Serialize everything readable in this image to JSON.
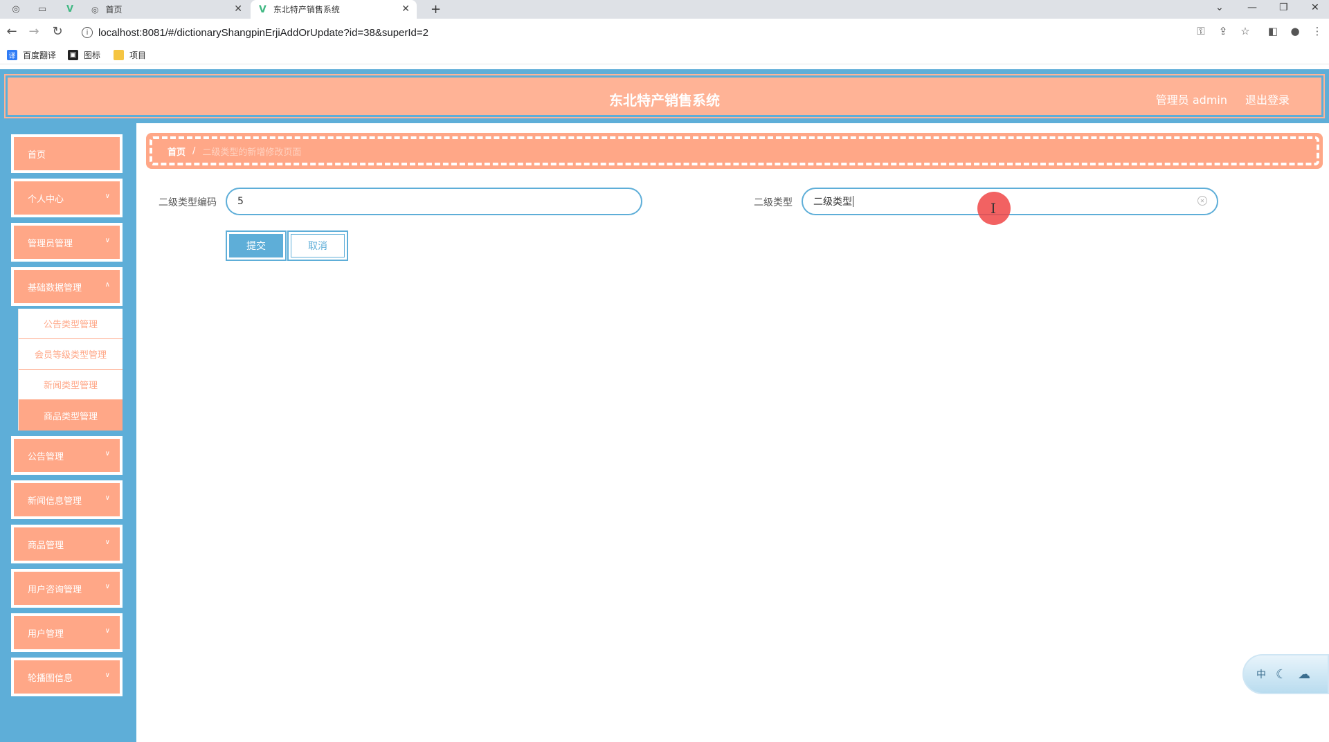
{
  "browser": {
    "tabs": [
      {
        "label": "首页",
        "active": false
      },
      {
        "label": "东北特产销售系统",
        "active": true
      }
    ],
    "new_tab": "+",
    "url": "localhost:8081/#/dictionaryShangpinErjiAddOrUpdate?id=38&superId=2",
    "bookmarks": [
      "百度翻译",
      "图标",
      "项目"
    ]
  },
  "header": {
    "title": "东北特产销售系统",
    "user": "管理员 admin",
    "logout": "退出登录"
  },
  "sidebar": {
    "items": [
      {
        "label": "首页",
        "has_arrow": false
      },
      {
        "label": "个人中心",
        "has_arrow": true
      },
      {
        "label": "管理员管理",
        "has_arrow": true
      },
      {
        "label": "基础数据管理",
        "has_arrow": true,
        "expanded": true
      },
      {
        "label": "公告管理",
        "has_arrow": true
      },
      {
        "label": "新闻信息管理",
        "has_arrow": true
      },
      {
        "label": "商品管理",
        "has_arrow": true
      },
      {
        "label": "用户咨询管理",
        "has_arrow": true
      },
      {
        "label": "用户管理",
        "has_arrow": true
      },
      {
        "label": "轮播图信息",
        "has_arrow": true
      }
    ],
    "submenu": [
      {
        "label": "公告类型管理",
        "active": false
      },
      {
        "label": "会员等级类型管理",
        "active": false
      },
      {
        "label": "新闻类型管理",
        "active": false
      },
      {
        "label": "商品类型管理",
        "active": true
      }
    ]
  },
  "breadcrumb": {
    "home": "首页",
    "separator": "/",
    "current": "二级类型的新增修改页面"
  },
  "form": {
    "code_label": "二级类型编码",
    "code_value": "5",
    "type_label": "二级类型",
    "type_value": "二级类型",
    "submit": "提交",
    "cancel": "取消"
  },
  "widget": {
    "label": "中"
  },
  "colors": {
    "primary_blue": "#5eaed8",
    "accent_salmon": "#ffa787",
    "header_salmon": "#ffb396"
  }
}
